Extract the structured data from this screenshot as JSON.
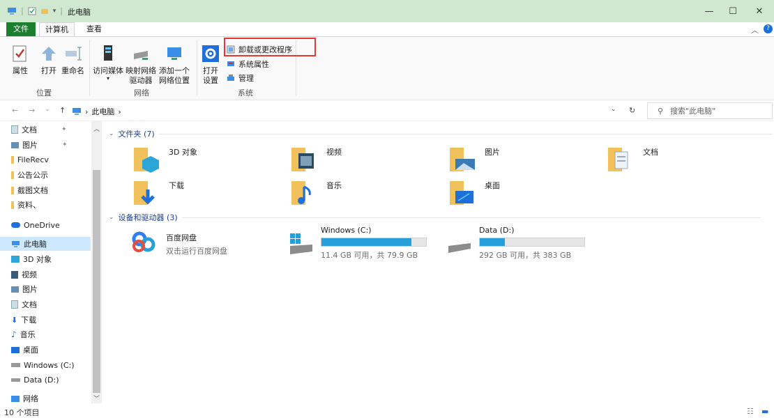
{
  "window": {
    "title": "此电脑",
    "minimize_icon": "minimize-icon",
    "maximize_icon": "maximize-icon",
    "close_icon": "close-icon"
  },
  "ribbon_tabs": {
    "file": "文件",
    "computer": "计算机",
    "view": "查看"
  },
  "ribbon": {
    "location": {
      "label": "位置",
      "properties": "属性",
      "open": "打开",
      "rename": "重命名"
    },
    "network": {
      "label": "网络",
      "media": "访问媒体",
      "map_drive_1": "映射网络",
      "map_drive_2": "驱动器",
      "add_loc_1": "添加一个",
      "add_loc_2": "网络位置"
    },
    "system": {
      "label": "系统",
      "open_settings_1": "打开",
      "open_settings_2": "设置",
      "uninstall": "卸载或更改程序",
      "system_props": "系统属性",
      "manage": "管理"
    }
  },
  "address": {
    "path_root": "此电脑",
    "search_placeholder": "搜索\"此电脑\""
  },
  "sidebar": {
    "quick": [
      "文档",
      "图片",
      "FileRecv",
      "公告公示",
      "截图文档",
      "资料、"
    ],
    "onedrive": "OneDrive",
    "this_pc": "此电脑",
    "pc_items": [
      "3D 对象",
      "视频",
      "图片",
      "文档",
      "下载",
      "音乐",
      "桌面",
      "Windows (C:)",
      "Data (D:)"
    ],
    "network": "网络"
  },
  "folders": {
    "header": "文件夹 (7)",
    "items": [
      "3D 对象",
      "视频",
      "图片",
      "文档",
      "下载",
      "音乐",
      "桌面"
    ]
  },
  "devices": {
    "header": "设备和驱动器 (3)",
    "baidu": {
      "name": "百度网盘",
      "sub": "双击运行百度网盘"
    },
    "c_drive": {
      "name": "Windows (C:)",
      "free": "11.4 GB 可用，共 79.9 GB",
      "used_fraction": 0.857
    },
    "d_drive": {
      "name": "Data (D:)",
      "free": "292 GB 可用，共 383 GB",
      "used_fraction": 0.238
    }
  },
  "status": {
    "count": "10 个项目"
  },
  "colors": {
    "accent": "#26a0da",
    "title_bar": "#cfe8cf",
    "file_tab": "#1a7f2e",
    "highlight": "#e53935"
  }
}
